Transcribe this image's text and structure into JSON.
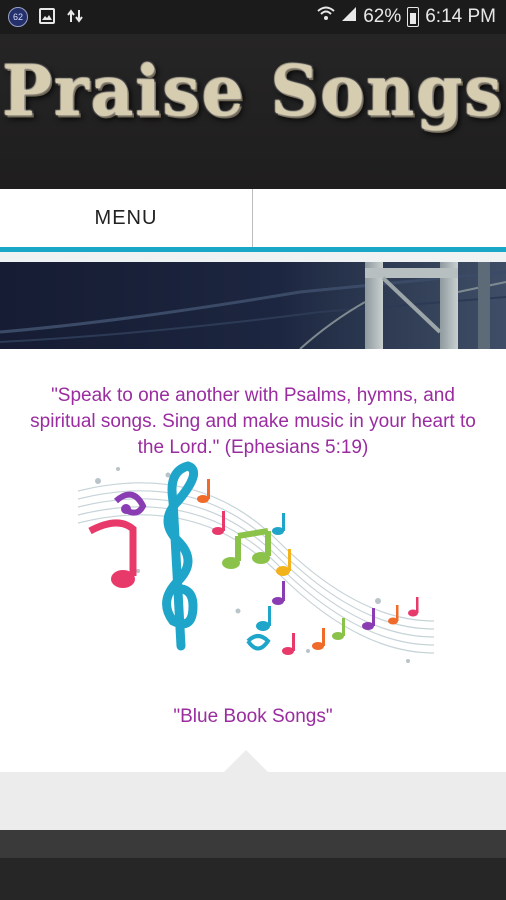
{
  "status_bar": {
    "notification_badge": "62",
    "battery_percent": "62%",
    "time": "6:14 PM",
    "icons": [
      "notification-badge-icon",
      "image-icon",
      "data-transfer-icon",
      "wifi-icon",
      "signal-icon",
      "battery-icon"
    ]
  },
  "header": {
    "logo_text": "Praise Songs"
  },
  "menu": {
    "label": "MENU"
  },
  "content": {
    "verse": "\"Speak to one another with Psalms, hymns, and spiritual songs. Sing and make music in your heart to the Lord.\" (Ephesians 5:19)",
    "link_label": "\"Blue Book Songs\""
  },
  "colors": {
    "accent_teal": "#19a7c8",
    "verse_purple": "#9a2ca0"
  }
}
